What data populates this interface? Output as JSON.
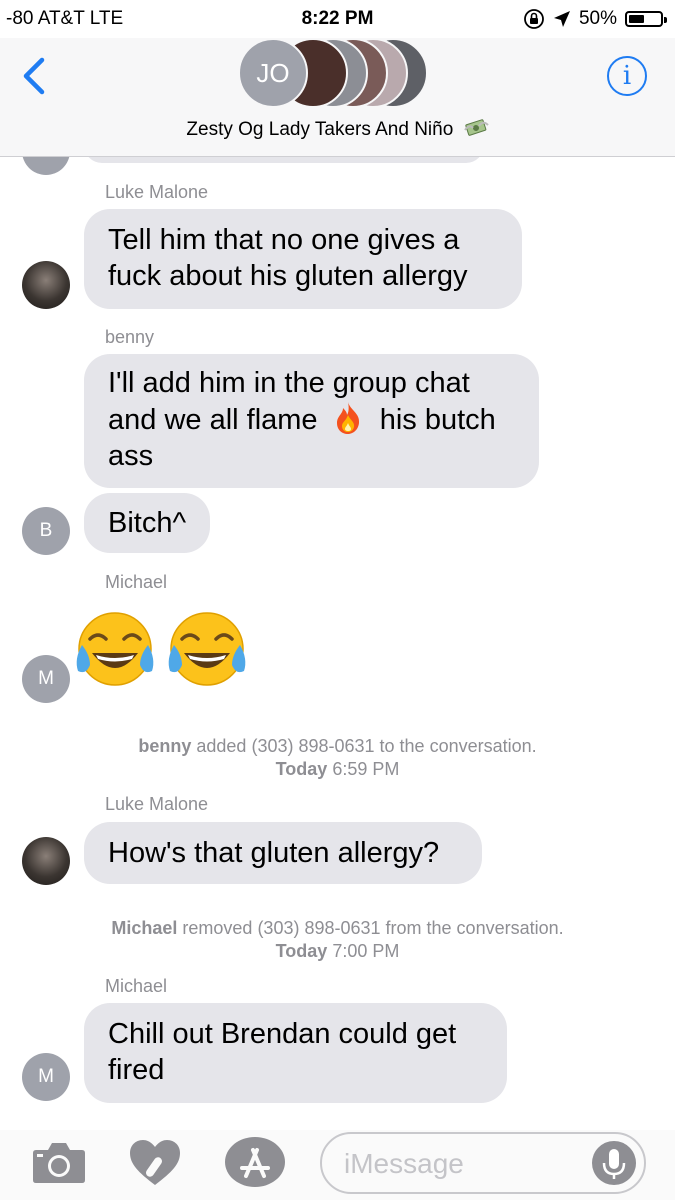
{
  "status": {
    "carrier": "-80 AT&T   LTE",
    "time": "8:22 PM",
    "battery": "50%",
    "battery_fill": 0.5
  },
  "header": {
    "avatar_initials": "JO",
    "title": "Zesty Og Lady Takers And Niño"
  },
  "messages": [
    {
      "sender": "Luke Malone",
      "text_lines": [
        "Tell him that no one gives a",
        "fuck about his gluten allergy"
      ]
    },
    {
      "sender": "benny",
      "text_lines": [
        "I'll add him in the group chat",
        "and we all flame",
        "his butch",
        "ass"
      ]
    },
    {
      "text": "Bitch^",
      "avatar": "B"
    },
    {
      "sender": "Michael",
      "emoji": "face-with-tears-of-joy x2",
      "avatar": "M"
    },
    {
      "system": {
        "actor": "benny",
        "action": "added (303) 898-0631 to the conversation.",
        "day": "Today",
        "time": "6:59 PM"
      }
    },
    {
      "sender": "Luke Malone",
      "text": "How's that gluten allergy?"
    },
    {
      "system": {
        "actor": "Michael",
        "action": "removed (303) 898-0631 from the conversation.",
        "day": "Today",
        "time": "7:00 PM"
      }
    },
    {
      "sender": "Michael",
      "text_lines": [
        "Chill out Brendan could get",
        "fired"
      ],
      "avatar": "M"
    }
  ],
  "input": {
    "placeholder": "iMessage"
  },
  "colors": {
    "accent": "#1f7cf2",
    "bubble": "#e5e5ea",
    "meta": "#8e8e93"
  }
}
